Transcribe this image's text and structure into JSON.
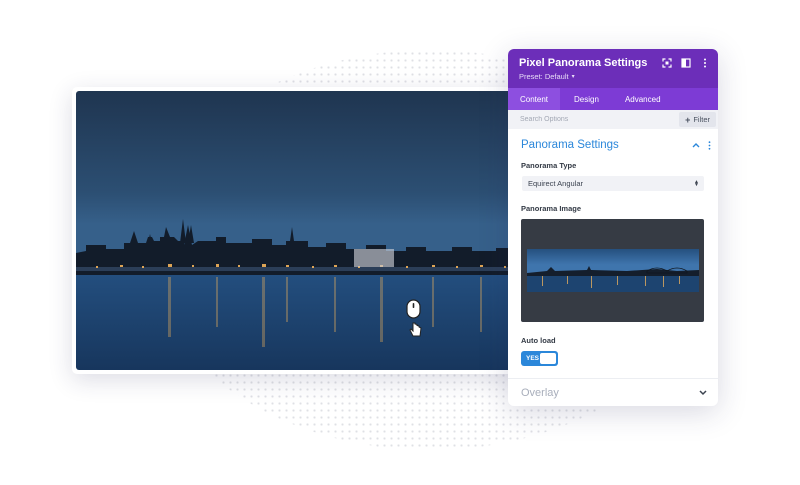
{
  "panel": {
    "title": "Pixel Panorama Settings",
    "preset": "Preset: Default",
    "header_icons": [
      "expand-icon",
      "split-view-icon",
      "more-vertical-icon"
    ],
    "tabs": [
      {
        "label": "Content",
        "active": true
      },
      {
        "label": "Design",
        "active": false
      },
      {
        "label": "Advanced",
        "active": false
      }
    ],
    "search_placeholder": "Search Options",
    "filter_label": "Filter",
    "section_title": "Panorama Settings",
    "panorama_type_label": "Panorama Type",
    "panorama_type_value": "Equirect Angular",
    "panorama_image_label": "Panorama Image",
    "auto_load_label": "Auto load",
    "auto_load_value": "YES",
    "overlay_title": "Overlay"
  },
  "colors": {
    "header": "#6c2eb9",
    "tabs_bar": "#7d3bd5",
    "active_tab": "#8d4fe0",
    "accent_blue": "#2b87da"
  }
}
